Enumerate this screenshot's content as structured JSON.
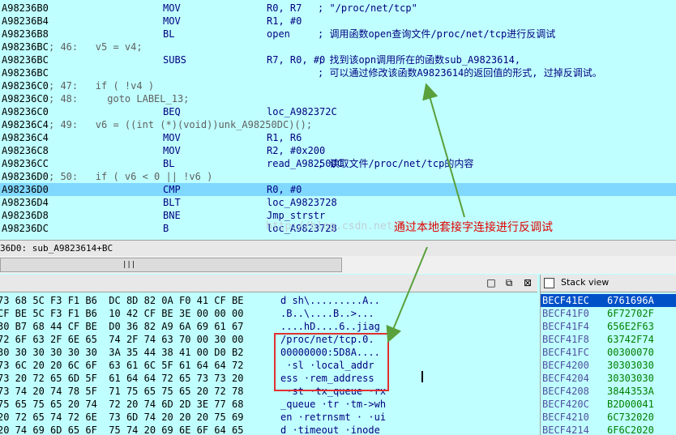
{
  "disasm": {
    "lines": [
      {
        "addr": "A98236B0",
        "pseudo": "",
        "mn": "MOV",
        "op": "R0, R7",
        "cm": "; \"/proc/net/tcp\"",
        "hl": false
      },
      {
        "addr": "A98236B4",
        "pseudo": "",
        "mn": "MOV",
        "op": "R1, #0",
        "cm": "",
        "hl": false
      },
      {
        "addr": "A98236B8",
        "pseudo": "",
        "mn": "BL",
        "op": "open",
        "cm": "; 调用函数open查询文件/proc/net/tcp进行反调试",
        "hl": false
      },
      {
        "addr": "A98236BC",
        "pseudo": "; 46:   v5 = v4;",
        "mn": "",
        "op": "",
        "cm": "",
        "hl": false
      },
      {
        "addr": "A98236BC",
        "pseudo": "",
        "mn": "SUBS",
        "op": "R7, R0, #0",
        "cm": "; 找到该opn调用所在的函数sub_A9823614,",
        "hl": false
      },
      {
        "addr": "A98236BC",
        "pseudo": "",
        "mn": "",
        "op": "",
        "cm": "; 可以通过修改该函数A9823614的返回值的形式, 过掉反调试。",
        "hl": false
      },
      {
        "addr": "A98236C0",
        "pseudo": "; 47:   if ( !v4 )",
        "mn": "",
        "op": "",
        "cm": "",
        "hl": false
      },
      {
        "addr": "A98236C0",
        "pseudo": "; 48:     goto LABEL_13;",
        "mn": "",
        "op": "",
        "cm": "",
        "hl": false
      },
      {
        "addr": "A98236C0",
        "pseudo": "",
        "mn": "BEQ",
        "op": "loc_A982372C",
        "cm": "",
        "hl": false
      },
      {
        "addr": "A98236C4",
        "pseudo": "; 49:   v6 = ((int (*)(void))unk_A98250DC)();",
        "mn": "",
        "op": "",
        "cm": "",
        "hl": false
      },
      {
        "addr": "A98236C4",
        "pseudo": "",
        "mn": "MOV",
        "op": "R1, R6",
        "cm": "",
        "hl": false
      },
      {
        "addr": "A98236C8",
        "pseudo": "",
        "mn": "MOV",
        "op": "R2, #0x200",
        "cm": "",
        "hl": false
      },
      {
        "addr": "A98236CC",
        "pseudo": "",
        "mn": "BL",
        "op": "read_A98250DC",
        "cm": "; 读取文件/proc/net/tcp的内容",
        "hl": false
      },
      {
        "addr": "A98236D0",
        "pseudo": "; 50:   if ( v6 < 0 || !v6 )",
        "mn": "",
        "op": "",
        "cm": "",
        "hl": false
      },
      {
        "addr": "A98236D0",
        "pseudo": "",
        "mn": "CMP",
        "op": "R0, #0",
        "cm": "",
        "hl": true
      },
      {
        "addr": "A98236D4",
        "pseudo": "",
        "mn": "BLT",
        "op": "loc_A9823728",
        "cm": "",
        "hl": false
      },
      {
        "addr": "A98236D8",
        "pseudo": "",
        "mn": "BNE",
        "op": "Jmp_strstr",
        "cm": "",
        "hl": false
      },
      {
        "addr": "A98236DC",
        "pseudo": "",
        "mn": "B",
        "op": "loc_A9823728",
        "cm": "",
        "hl": false
      }
    ]
  },
  "status": {
    "text": "36D0: sub_A9823614+BC"
  },
  "annotation": {
    "text": "通过本地套接字连接进行反调试"
  },
  "watermark": {
    "text": "http://blog.csdn.net/"
  },
  "hex": {
    "header_buttons": [
      "□",
      "⧉",
      "⊠"
    ],
    "lines": [
      {
        "bytes": "73 68 5C F3 F1 B6  DC 8D 82 0A F0 41 CF BE",
        "ascii": "d sh\\.........A.."
      },
      {
        "bytes": "CF BE 5C F3 F1 B6  10 42 CF BE 3E 00 00 00",
        "ascii": ".B..\\....B..>..."
      },
      {
        "bytes": "30 B7 68 44 CF BE  D0 36 82 A9 6A 69 61 67",
        "ascii": "....hD....6..jiag"
      },
      {
        "bytes": "72 6F 63 2F 6E 65  74 2F 74 63 70 00 30 00",
        "ascii": "/proc/net/tcp.0."
      },
      {
        "bytes": "30 30 30 30 30 30  3A 35 44 38 41 00 D0 B2",
        "ascii": "00000000:5D8A...."
      },
      {
        "bytes": "73 6C 20 20 6C 6F  63 61 6C 5F 61 64 64 72",
        "ascii": " ·sl ·local_addr"
      },
      {
        "bytes": "73 20 72 65 6D 5F  61 64 64 72 65 73 73 20",
        "ascii": "ess ·rem_address"
      },
      {
        "bytes": "73 74 20 74 78 5F  71 75 65 75 65 20 72 78",
        "ascii": " ·st ·tx_queue ·rx"
      },
      {
        "bytes": "75 65 75 65 20 74  72 20 74 6D 2D 3E 77 68",
        "ascii": "_queue ·tr ·tm->wh"
      },
      {
        "bytes": "20 72 65 74 72 6E  73 6D 74 20 20 20 75 69",
        "ascii": "en ·retrnsmt · ·ui"
      },
      {
        "bytes": "20 74 69 6D 65 6F  75 74 20 69 6E 6F 64 65",
        "ascii": "d ·timeout ·inode"
      }
    ]
  },
  "stack": {
    "title": "Stack view",
    "rows": [
      {
        "addr": "BECF41EC",
        "val": "6761696A",
        "hl": true
      },
      {
        "addr": "BECF41F0",
        "val": "6F72702F",
        "hl": false
      },
      {
        "addr": "BECF41F4",
        "val": "656E2F63",
        "hl": false
      },
      {
        "addr": "BECF41F8",
        "val": "63742F74",
        "hl": false
      },
      {
        "addr": "BECF41FC",
        "val": "00300070",
        "hl": false
      },
      {
        "addr": "BECF4200",
        "val": "30303030",
        "hl": false
      },
      {
        "addr": "BECF4204",
        "val": "30303030",
        "hl": false
      },
      {
        "addr": "BECF4208",
        "val": "3844353A",
        "hl": false
      },
      {
        "addr": "BECF420C",
        "val": "B2D00041",
        "hl": false
      },
      {
        "addr": "BECF4210",
        "val": "6C732020",
        "hl": false
      },
      {
        "addr": "BECF4214",
        "val": "6F6C2020",
        "hl": false
      }
    ]
  }
}
